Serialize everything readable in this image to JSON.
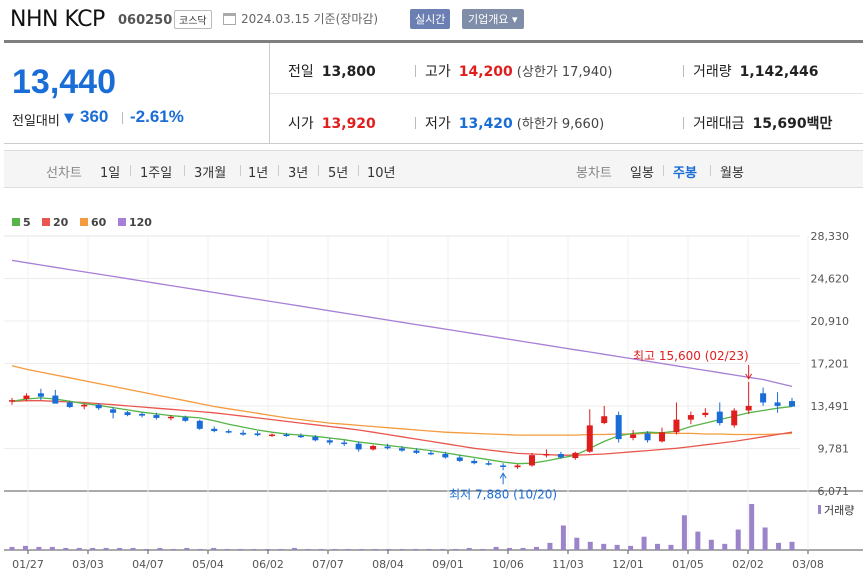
{
  "header": {
    "stock_name": "NHN KCP",
    "stock_code": "060250",
    "market": "코스닥",
    "date_basis": "2024.03.15 기준(장마감)",
    "realtime_label": "실시간",
    "overview_label": "기업개요 ▾"
  },
  "quote": {
    "current_price": "13,440",
    "change_label": "전일대비",
    "change_amount": "360",
    "change_percent": "-2.61%",
    "prev_close_label": "전일",
    "prev_close": "13,800",
    "high_label": "고가",
    "high": "14,200",
    "upper_limit": "(상한가 17,940)",
    "volume_label": "거래량",
    "volume": "1,142,446",
    "open_label": "시가",
    "open": "13,920",
    "low_label": "저가",
    "low": "13,420",
    "lower_limit": "(하한가 9,660)",
    "trade_value_label": "거래대금",
    "trade_value": "15,690",
    "trade_value_unit": "백만"
  },
  "tabs": {
    "line_chart_label": "선차트",
    "periods": [
      "1일",
      "1주일",
      "3개월",
      "1년",
      "3년",
      "5년",
      "10년"
    ],
    "candle_chart_label": "봉차트",
    "candle_periods": [
      "일봉",
      "주봉",
      "월봉"
    ],
    "active_candle": "주봉"
  },
  "colors": {
    "up": "#e01e1e",
    "down": "#1a6dd6",
    "ma5": "#55b546",
    "ma20": "#e8574f",
    "ma60": "#f59a3e",
    "ma120": "#a77fd6",
    "volume": "#9b84c9"
  },
  "chart_data": {
    "type": "candlestick",
    "legend": [
      "5",
      "20",
      "60",
      "120"
    ],
    "y_ticks": [
      "28,330",
      "24,620",
      "20,910",
      "17,201",
      "13,491",
      "9,781",
      "6,071"
    ],
    "y_range": [
      6071,
      28330
    ],
    "x_labels": [
      "01/27",
      "03/03",
      "04/07",
      "05/04",
      "06/02",
      "07/07",
      "08/04",
      "09/01",
      "10/06",
      "11/03",
      "12/01",
      "01/05",
      "02/02",
      "03/08"
    ],
    "annotation_high": "최고 15,600 (02/23)",
    "annotation_low": "최저 7,880 (10/20)",
    "volume_label": "거래량",
    "candles": [
      {
        "o": 13900,
        "h": 14200,
        "l": 13600,
        "c": 14000
      },
      {
        "o": 14100,
        "h": 14600,
        "l": 13900,
        "c": 14400
      },
      {
        "o": 14600,
        "h": 15000,
        "l": 14000,
        "c": 14300
      },
      {
        "o": 14400,
        "h": 14900,
        "l": 13900,
        "c": 13700
      },
      {
        "o": 13800,
        "h": 13950,
        "l": 13300,
        "c": 13400
      },
      {
        "o": 13450,
        "h": 13700,
        "l": 13200,
        "c": 13600
      },
      {
        "o": 13600,
        "h": 13750,
        "l": 13150,
        "c": 13300
      },
      {
        "o": 13200,
        "h": 13400,
        "l": 12400,
        "c": 12900
      },
      {
        "o": 12950,
        "h": 13050,
        "l": 12600,
        "c": 12700
      },
      {
        "o": 12800,
        "h": 12950,
        "l": 12500,
        "c": 12650
      },
      {
        "o": 12700,
        "h": 12900,
        "l": 12300,
        "c": 12450
      },
      {
        "o": 12450,
        "h": 12700,
        "l": 12250,
        "c": 12550
      },
      {
        "o": 12500,
        "h": 12650,
        "l": 12100,
        "c": 12200
      },
      {
        "o": 12200,
        "h": 12300,
        "l": 11400,
        "c": 11500
      },
      {
        "o": 11500,
        "h": 11700,
        "l": 11200,
        "c": 11300
      },
      {
        "o": 11300,
        "h": 11450,
        "l": 11100,
        "c": 11200
      },
      {
        "o": 11150,
        "h": 11400,
        "l": 10900,
        "c": 11000
      },
      {
        "o": 11100,
        "h": 11300,
        "l": 10850,
        "c": 10950
      },
      {
        "o": 10950,
        "h": 11100,
        "l": 10800,
        "c": 11000
      },
      {
        "o": 11000,
        "h": 11150,
        "l": 10800,
        "c": 10900
      },
      {
        "o": 10900,
        "h": 11100,
        "l": 10700,
        "c": 10800
      },
      {
        "o": 10800,
        "h": 10950,
        "l": 10400,
        "c": 10500
      },
      {
        "o": 10500,
        "h": 10700,
        "l": 10100,
        "c": 10300
      },
      {
        "o": 10300,
        "h": 10500,
        "l": 10000,
        "c": 10250
      },
      {
        "o": 10200,
        "h": 10400,
        "l": 9500,
        "c": 9700
      },
      {
        "o": 9700,
        "h": 10100,
        "l": 9600,
        "c": 10000
      },
      {
        "o": 9950,
        "h": 10200,
        "l": 9700,
        "c": 9800
      },
      {
        "o": 9800,
        "h": 10000,
        "l": 9500,
        "c": 9600
      },
      {
        "o": 9600,
        "h": 9800,
        "l": 9300,
        "c": 9400
      },
      {
        "o": 9400,
        "h": 9600,
        "l": 9200,
        "c": 9300
      },
      {
        "o": 9300,
        "h": 9500,
        "l": 8900,
        "c": 9000
      },
      {
        "o": 9000,
        "h": 9200,
        "l": 8600,
        "c": 8700
      },
      {
        "o": 8700,
        "h": 8900,
        "l": 8400,
        "c": 8500
      },
      {
        "o": 8500,
        "h": 8700,
        "l": 8300,
        "c": 8400
      },
      {
        "o": 8300,
        "h": 8500,
        "l": 7880,
        "c": 8200
      },
      {
        "o": 8150,
        "h": 8400,
        "l": 8000,
        "c": 8300
      },
      {
        "o": 8300,
        "h": 9400,
        "l": 8200,
        "c": 9200
      },
      {
        "o": 9200,
        "h": 9700,
        "l": 9000,
        "c": 9300
      },
      {
        "o": 9300,
        "h": 9500,
        "l": 8900,
        "c": 9000
      },
      {
        "o": 8950,
        "h": 9500,
        "l": 8800,
        "c": 9400
      },
      {
        "o": 9500,
        "h": 13200,
        "l": 9400,
        "c": 11800
      },
      {
        "o": 12000,
        "h": 13500,
        "l": 11900,
        "c": 12600
      },
      {
        "o": 12700,
        "h": 13000,
        "l": 10300,
        "c": 10600
      },
      {
        "o": 10700,
        "h": 11400,
        "l": 10500,
        "c": 11000
      },
      {
        "o": 11100,
        "h": 11300,
        "l": 10300,
        "c": 10500
      },
      {
        "o": 10400,
        "h": 11600,
        "l": 10300,
        "c": 11200
      },
      {
        "o": 11200,
        "h": 13800,
        "l": 11000,
        "c": 12300
      },
      {
        "o": 12300,
        "h": 13000,
        "l": 11900,
        "c": 12700
      },
      {
        "o": 12700,
        "h": 13300,
        "l": 12500,
        "c": 12900
      },
      {
        "o": 13000,
        "h": 13800,
        "l": 11800,
        "c": 12000
      },
      {
        "o": 11800,
        "h": 13300,
        "l": 11600,
        "c": 13100
      },
      {
        "o": 13100,
        "h": 15600,
        "l": 12800,
        "c": 13500
      },
      {
        "o": 14600,
        "h": 15100,
        "l": 13500,
        "c": 13800
      },
      {
        "o": 13800,
        "h": 14700,
        "l": 12900,
        "c": 13500
      },
      {
        "o": 13920,
        "h": 14200,
        "l": 13420,
        "c": 13440
      }
    ],
    "ma5": [
      13900,
      14100,
      14200,
      14100,
      13900,
      13700,
      13550,
      13350,
      13150,
      12950,
      12800,
      12650,
      12550,
      12450,
      12200,
      11900,
      11650,
      11400,
      11200,
      11050,
      10950,
      10850,
      10700,
      10550,
      10350,
      10200,
      10050,
      9900,
      9750,
      9600,
      9400,
      9200,
      9000,
      8800,
      8600,
      8450,
      8500,
      8700,
      8950,
      9200,
      9800,
      10400,
      10900,
      11100,
      11200,
      11150,
      11300,
      11700,
      12000,
      12300,
      12600,
      12900,
      13100,
      13300,
      13450
    ],
    "ma20": [
      13900,
      13950,
      13950,
      13900,
      13850,
      13800,
      13700,
      13600,
      13500,
      13400,
      13300,
      13200,
      13100,
      13000,
      12900,
      12750,
      12600,
      12450,
      12300,
      12150,
      12000,
      11850,
      11700,
      11550,
      11400,
      11200,
      11000,
      10800,
      10600,
      10400,
      10200,
      10000,
      9800,
      9650,
      9500,
      9350,
      9300,
      9250,
      9200,
      9200,
      9250,
      9300,
      9400,
      9500,
      9600,
      9700,
      9800,
      9950,
      10100,
      10250,
      10400,
      10600,
      10800,
      11000,
      11200
    ],
    "ma60": [
      17000,
      16700,
      16450,
      16200,
      15950,
      15700,
      15450,
      15200,
      14950,
      14700,
      14450,
      14200,
      13950,
      13700,
      13450,
      13250,
      13050,
      12850,
      12650,
      12450,
      12300,
      12150,
      12000,
      11900,
      11800,
      11700,
      11600,
      11500,
      11400,
      11300,
      11200,
      11150,
      11100,
      11050,
      11000,
      10950,
      10950,
      10950,
      10950,
      10950,
      11000,
      11000,
      11050,
      11050,
      11100,
      11100,
      11100,
      11100,
      11050,
      11050,
      11000,
      11000,
      11000,
      11050,
      11100
    ],
    "ma120": [
      26200,
      26000,
      25800,
      25600,
      25400,
      25200,
      25000,
      24800,
      24600,
      24400,
      24200,
      24000,
      23800,
      23600,
      23400,
      23200,
      23000,
      22800,
      22600,
      22400,
      22200,
      22000,
      21800,
      21600,
      21400,
      21200,
      21000,
      20800,
      20600,
      20400,
      20200,
      20000,
      19800,
      19600,
      19400,
      19200,
      19000,
      18800,
      18600,
      18400,
      18200,
      18000,
      17800,
      17600,
      17400,
      17200,
      17000,
      16800,
      16600,
      16400,
      16200,
      16000,
      15800,
      15500,
      15200
    ],
    "volume": [
      3,
      4,
      3,
      3,
      2,
      2,
      2,
      2,
      2,
      2,
      1,
      2,
      1,
      2,
      1,
      2,
      1,
      1,
      1,
      1,
      1,
      2,
      1,
      1,
      1,
      1,
      1,
      1,
      1,
      1,
      1,
      1,
      1,
      1,
      2,
      1,
      3,
      2,
      2,
      3,
      7,
      24,
      12,
      8,
      6,
      5,
      4,
      13,
      6,
      5,
      34,
      18,
      10,
      6,
      20,
      45,
      22,
      7,
      8
    ]
  }
}
